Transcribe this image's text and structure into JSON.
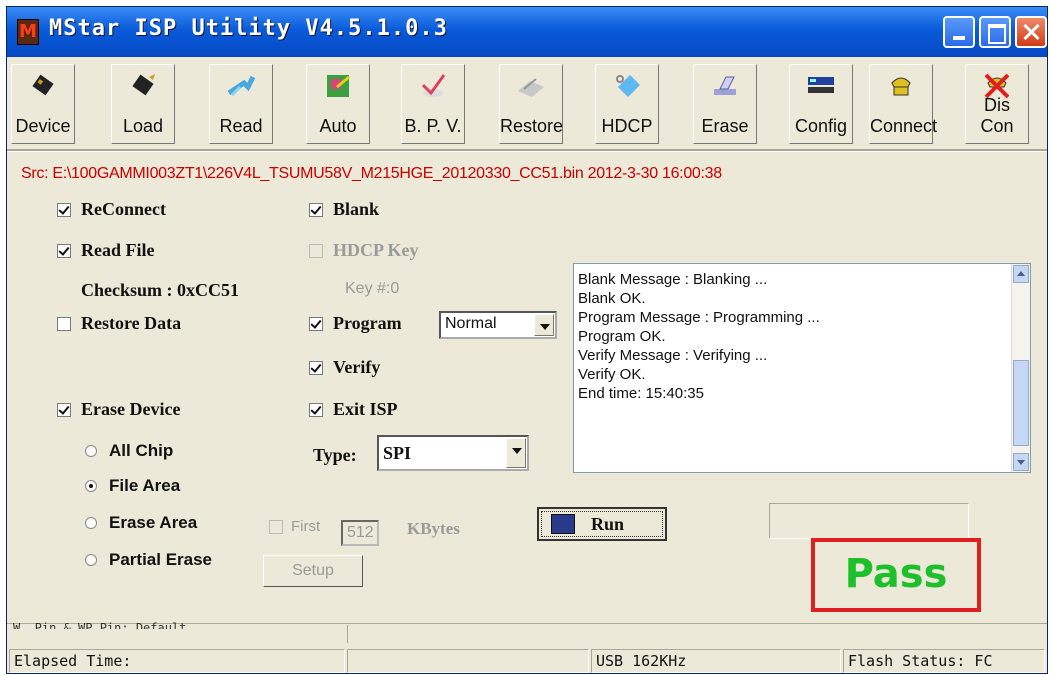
{
  "window": {
    "title": "MStar ISP Utility V4.5.1.0.3",
    "app_icon_letter": "M"
  },
  "toolbar": {
    "buttons": [
      {
        "label": "Device",
        "icon": "chip-icon"
      },
      {
        "label": "Load",
        "icon": "chip-load-icon"
      },
      {
        "label": "Read",
        "icon": "read-arrow-icon"
      },
      {
        "label": "Auto",
        "icon": "auto-icon"
      },
      {
        "label": "B. P. V.",
        "icon": "check-icon"
      },
      {
        "label": "Restore",
        "icon": "restore-icon"
      },
      {
        "label": "HDCP",
        "icon": "hdcp-icon"
      },
      {
        "label": "Erase",
        "icon": "eraser-icon"
      },
      {
        "label": "Config",
        "icon": "config-icon"
      },
      {
        "label": "Connect",
        "icon": "phone-icon"
      },
      {
        "label": "Dis Con",
        "icon": "disconnect-icon"
      }
    ]
  },
  "source_path": "Src: E:\\100GAMMI003ZT1\\226V4L_TSUMU58V_M215HGE_20120330_CC51.bin 2012-3-30 16:00:38",
  "options": {
    "reconnect": {
      "label": "ReConnect",
      "checked": true
    },
    "read_file": {
      "label": "Read File",
      "checked": true
    },
    "checksum_label": "Checksum : 0xCC51",
    "restore_data": {
      "label": "Restore Data",
      "checked": false
    },
    "erase_device": {
      "label": "Erase Device",
      "checked": true
    },
    "blank": {
      "label": "Blank",
      "checked": true
    },
    "hdcp_key": {
      "label": "HDCP Key",
      "checked": false,
      "disabled": true
    },
    "key_index": "Key #:0",
    "program": {
      "label": "Program",
      "checked": true
    },
    "program_mode": "Normal",
    "verify": {
      "label": "Verify",
      "checked": true
    },
    "exit_isp": {
      "label": "Exit ISP",
      "checked": true
    },
    "type_label": "Type:",
    "type_value": "SPI"
  },
  "erase_modes": {
    "all_chip": "All Chip",
    "file_area": "File Area",
    "erase_area": "Erase Area",
    "partial_erase": "Partial Erase",
    "selected": "File Area"
  },
  "first": {
    "label": "First",
    "value": "512",
    "unit": "KBytes"
  },
  "buttons": {
    "run": "Run",
    "setup": "Setup"
  },
  "log": {
    "lines": [
      "Blank Message : Blanking ...",
      "Blank OK.",
      "Program Message : Programming ...",
      "Program OK.",
      "Verify Message : Verifying ...",
      "Verify OK.",
      "End time: 15:40:35"
    ]
  },
  "result": {
    "text": "Pass",
    "color": "#1dbf2a",
    "border_color": "#e02020"
  },
  "status": {
    "cut_text": "W. Pin & WP Pin: Default",
    "elapsed": "Elapsed Time:",
    "usb": "USB  162KHz",
    "flash_status": "Flash Status: FC"
  },
  "colors": {
    "title_bar": "#0a5bd9",
    "source_text": "#c80000",
    "face": "#ece9d8"
  }
}
